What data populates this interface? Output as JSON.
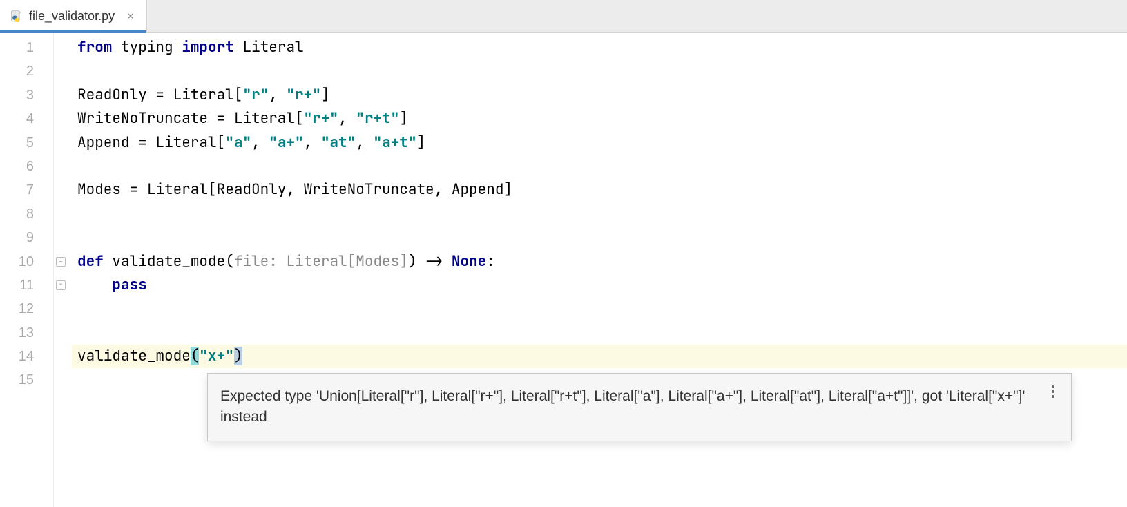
{
  "tab": {
    "filename": "file_validator.py"
  },
  "gutter": {
    "lines": [
      "1",
      "2",
      "3",
      "4",
      "5",
      "6",
      "7",
      "8",
      "9",
      "10",
      "11",
      "12",
      "13",
      "14",
      "15"
    ]
  },
  "code": {
    "l1": {
      "from": "from",
      "typing": "typing",
      "import": "import",
      "literal": "Literal"
    },
    "l3": {
      "name": "ReadOnly",
      "eq": " = ",
      "lit": "Literal",
      "b1": "[",
      "s1": "\"r\"",
      "c": ", ",
      "s2": "\"r+\"",
      "b2": "]"
    },
    "l4": {
      "name": "WriteNoTruncate",
      "eq": " = ",
      "lit": "Literal",
      "b1": "[",
      "s1": "\"r+\"",
      "c": ", ",
      "s2": "\"r+t\"",
      "b2": "]"
    },
    "l5": {
      "name": "Append",
      "eq": " = ",
      "lit": "Literal",
      "b1": "[",
      "s1": "\"a\"",
      "c1": ", ",
      "s2": "\"a+\"",
      "c2": ", ",
      "s3": "\"at\"",
      "c3": ", ",
      "s4": "\"a+t\"",
      "b2": "]"
    },
    "l7": {
      "name": "Modes",
      "eq": " = ",
      "lit": "Literal",
      "b1": "[",
      "a1": "ReadOnly",
      "c1": ", ",
      "a2": "WriteNoTruncate",
      "c2": ", ",
      "a3": "Append",
      "b2": "]"
    },
    "l10": {
      "def": "def",
      "fn": "validate_mode",
      "p1": "(",
      "hint": "file: Literal[Modes]",
      "p2": ")",
      "arrow": " -> ",
      "none": "None",
      "colon": ":"
    },
    "l11": {
      "pass": "pass"
    },
    "l14": {
      "fn": "validate_mode",
      "p1": "(",
      "arg": "\"x+\"",
      "p2": ")"
    }
  },
  "tooltip": {
    "message": "Expected type 'Union[Literal[\"r\"], Literal[\"r+\"], Literal[\"r+t\"], Literal[\"a\"], Literal[\"a+\"], Literal[\"at\"], Literal[\"a+t\"]]', got 'Literal[\"x+\"]' instead"
  }
}
